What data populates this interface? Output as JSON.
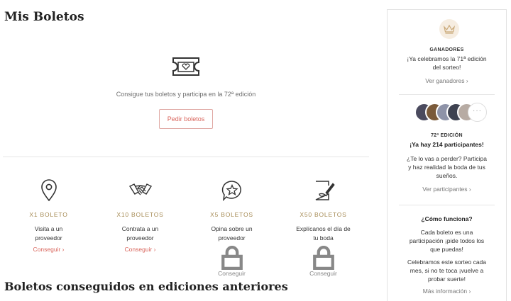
{
  "header": {
    "title": "Mis Boletos"
  },
  "hero": {
    "text": "Consigue tus boletos y participa en la 72ª edición",
    "button_label": "Pedir boletos"
  },
  "ways": [
    {
      "icon": "map-pin-icon",
      "title": "X1 BOLETO",
      "desc_line1": "Visita a un",
      "desc_line2": "proveedor",
      "link": "Conseguir",
      "locked": false
    },
    {
      "icon": "handshake-icon",
      "title": "X10 BOLETOS",
      "desc_line1": "Contrata a un",
      "desc_line2": "proveedor",
      "link": "Conseguir",
      "locked": false
    },
    {
      "icon": "star-chat-icon",
      "title": "X5 BOLETOS",
      "desc_line1": "Opina sobre un",
      "desc_line2": "proveedor",
      "link": "Conseguir",
      "locked": true
    },
    {
      "icon": "document-pen-icon",
      "title": "X50 BOLETOS",
      "desc_line1": "Explícanos el día de",
      "desc_line2": "tu boda",
      "link": "Conseguir",
      "locked": true
    }
  ],
  "previous": {
    "title": "Boletos conseguidos en ediciones anteriores"
  },
  "sidebar": {
    "winners": {
      "heading": "GANADORES",
      "line1": "¡Ya celebramos la 71ª edición",
      "line2": "del sorteo!",
      "link": "Ver ganadores"
    },
    "participants": {
      "edition": "72ª EDICIÓN",
      "headline": "¡Ya hay 214 participantes!",
      "line1": "¿Te lo vas a perder? Participa",
      "line2": "y haz realidad la boda de tus",
      "line3": "sueños.",
      "link": "Ver participantes",
      "more": "···"
    },
    "how": {
      "heading": "¿Cómo funciona?",
      "p1_line1": "Cada boleto es una",
      "p1_line2": "participación ¡pide todos los",
      "p1_line3": "que puedas!",
      "p2_line1": "Celebramos este sorteo cada",
      "p2_line2": "mes, si no te toca ¡vuelve a",
      "p2_line3": "probar suerte!",
      "link": "Más información"
    }
  },
  "colors": {
    "accent": "#d9655c",
    "gold": "#a68b55",
    "border": "#e2e2e2"
  }
}
